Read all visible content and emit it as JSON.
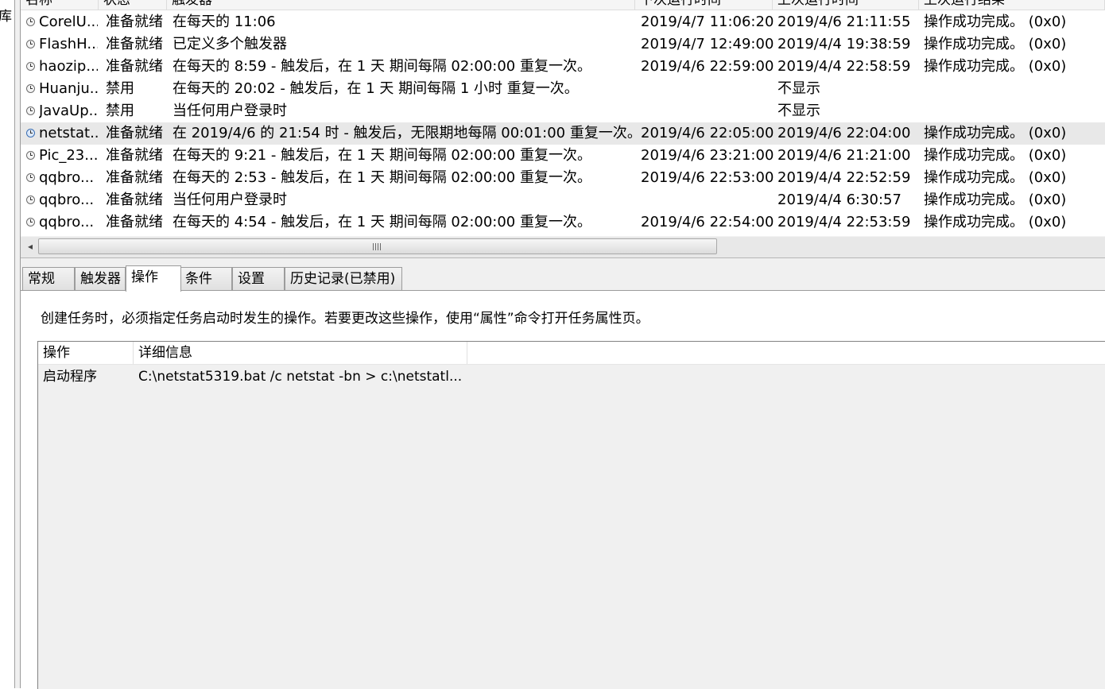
{
  "left_tree": {
    "fragment_text": "库"
  },
  "task_list": {
    "columns": [
      "名称",
      "状态",
      "触发器",
      "下次运行时间",
      "上次运行时间",
      "上次运行结果"
    ],
    "rows": [
      {
        "name": "CorelU...",
        "status": "准备就绪",
        "trigger": "在每天的 11:06",
        "next_run": "2019/4/7 11:06:20",
        "last_run": "2019/4/6 21:11:55",
        "last_result": "操作成功完成。 (0x0)"
      },
      {
        "name": "FlashH...",
        "status": "准备就绪",
        "trigger": "已定义多个触发器",
        "next_run": "2019/4/7 12:49:00",
        "last_run": "2019/4/4 19:38:59",
        "last_result": "操作成功完成。 (0x0)"
      },
      {
        "name": "haozip...",
        "status": "准备就绪",
        "trigger": "在每天的 8:59 - 触发后，在 1 天 期间每隔 02:00:00 重复一次。",
        "next_run": "2019/4/6 22:59:00",
        "last_run": "2019/4/4 22:58:59",
        "last_result": "操作成功完成。 (0x0)"
      },
      {
        "name": "Huanju...",
        "status": "禁用",
        "trigger": "在每天的 20:02 - 触发后，在 1 天 期间每隔 1 小时 重复一次。",
        "next_run": "",
        "last_run": "不显示",
        "last_result": ""
      },
      {
        "name": "JavaUp...",
        "status": "禁用",
        "trigger": "当任何用户登录时",
        "next_run": "",
        "last_run": "不显示",
        "last_result": ""
      },
      {
        "name": "netstat...",
        "status": "准备就绪",
        "trigger": "在 2019/4/6 的 21:54 时 - 触发后，无限期地每隔 00:01:00 重复一次。",
        "next_run": "2019/4/6 22:05:00",
        "last_run": "2019/4/6 22:04:00",
        "last_result": "操作成功完成。 (0x0)",
        "selected": true
      },
      {
        "name": "Pic_23...",
        "status": "准备就绪",
        "trigger": "在每天的 9:21 - 触发后，在 1 天 期间每隔 02:00:00 重复一次。",
        "next_run": "2019/4/6 23:21:00",
        "last_run": "2019/4/6 21:21:00",
        "last_result": "操作成功完成。 (0x0)"
      },
      {
        "name": "qqbro...",
        "status": "准备就绪",
        "trigger": "在每天的 2:53 - 触发后，在 1 天 期间每隔 02:00:00 重复一次。",
        "next_run": "2019/4/6 22:53:00",
        "last_run": "2019/4/4 22:52:59",
        "last_result": "操作成功完成。 (0x0)"
      },
      {
        "name": "qqbro...",
        "status": "准备就绪",
        "trigger": "当任何用户登录时",
        "next_run": "",
        "last_run": "2019/4/4 6:30:57",
        "last_result": "操作成功完成。 (0x0)"
      },
      {
        "name": "qqbro...",
        "status": "准备就绪",
        "trigger": "在每天的 4:54 - 触发后，在 1 天 期间每隔 02:00:00 重复一次。",
        "next_run": "2019/4/6 22:54:00",
        "last_run": "2019/4/4 22:53:59",
        "last_result": "操作成功完成。 (0x0)"
      }
    ]
  },
  "details": {
    "tabs": [
      "常规",
      "触发器",
      "操作",
      "条件",
      "设置",
      "历史记录(已禁用)"
    ],
    "active_tab": "操作",
    "description": "创建任务时，必须指定任务启动时发生的操作。若要更改这些操作，使用“属性”命令打开任务属性页。",
    "actions_columns": [
      "操作",
      "详细信息"
    ],
    "actions": [
      {
        "action": "启动程序",
        "detail": "C:\\netstat5319.bat /c netstat -bn > c:\\netstatl..."
      }
    ]
  },
  "colors": {
    "selected_row": "#e8e8e8",
    "pane_background": "#f0f0f0"
  }
}
